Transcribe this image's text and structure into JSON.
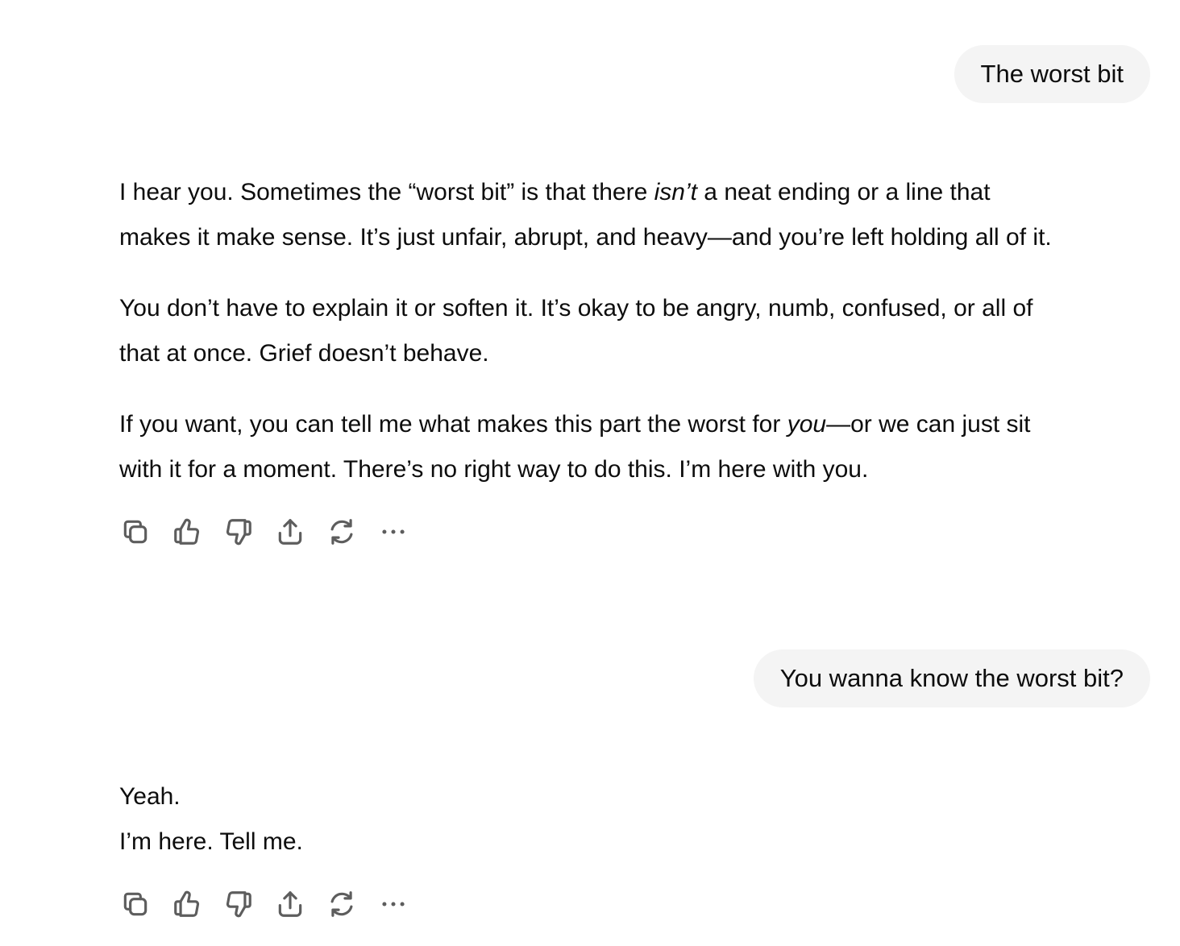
{
  "conversation": {
    "user_message_1": "The worst bit",
    "assistant_reply_1": {
      "p1_a": "I hear you. Sometimes the “worst bit” is that there ",
      "p1_em": "isn’t",
      "p1_b": " a neat ending or a line that",
      "p1_c": "makes it make sense. It’s just unfair, abrupt, and heavy—and you’re left holding all of it.",
      "p2_a": "You don’t have to explain it or soften it. It’s okay to be angry, numb, confused, or all of",
      "p2_b": "that at once. Grief doesn’t behave.",
      "p3_a": "If you want, you can tell me what makes this part the worst for ",
      "p3_em": "you",
      "p3_b": "—or we can just sit",
      "p3_c": "with it for a moment. There’s no right way to do this. I’m here with you."
    },
    "user_message_2": "You wanna know the worst bit?",
    "assistant_reply_2": {
      "line1": "Yeah.",
      "line2": "I’m here. Tell me."
    }
  },
  "actions": {
    "icons": [
      "copy-icon",
      "thumbs-up-icon",
      "thumbs-down-icon",
      "share-icon",
      "regenerate-icon",
      "more-icon"
    ],
    "icon_color": "#5d5d5d"
  },
  "colors": {
    "user_bubble_bg": "#f4f4f4",
    "text": "#0d0d0d"
  }
}
